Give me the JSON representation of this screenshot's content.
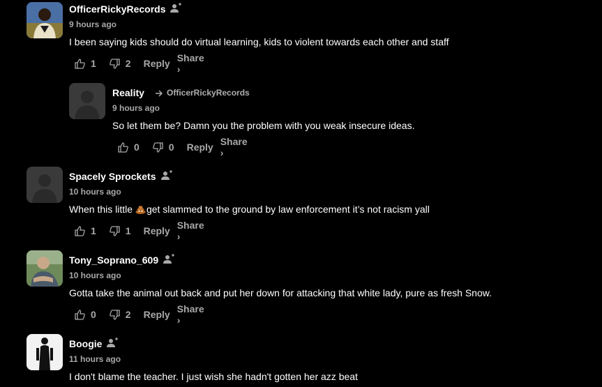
{
  "comments": [
    {
      "author": "OfficerRickyRecords",
      "time": "9 hours ago",
      "text": "I been saying kids should do virtual learning, kids to violent towards each other and staff",
      "likes": "1",
      "dislikes": "2",
      "reply_label": "Reply",
      "share_label": "Share ›",
      "avatar_icon": "user-photo-icon"
    },
    {
      "author": "Reality",
      "reply_to": "OfficerRickyRecords",
      "time": "9 hours ago",
      "text": "So let them be? Damn you the problem with you weak insecure ideas.",
      "likes": "0",
      "dislikes": "0",
      "reply_label": "Reply",
      "share_label": "Share ›",
      "avatar_icon": "default-avatar-icon"
    },
    {
      "author": "Spacely Sprockets",
      "time": "10 hours ago",
      "text_before": "When this little ",
      "text_after": "get slammed to the ground by law enforcement it’s not racism yall",
      "emoji": "poop-emoji-icon",
      "likes": "1",
      "dislikes": "1",
      "reply_label": "Reply",
      "share_label": "Share ›",
      "avatar_icon": "default-avatar-icon"
    },
    {
      "author": "Tony_Soprano_609",
      "time": "10 hours ago",
      "text": "Gotta take the animal out back and put her down for attacking that white lady, pure as fresh Snow.",
      "likes": "0",
      "dislikes": "2",
      "reply_label": "Reply",
      "share_label": "Share ›",
      "avatar_icon": "user-photo-icon"
    },
    {
      "author": "Boogie",
      "time": "11 hours ago",
      "text": "I don't blame the teacher. I just wish she hadn't gotten her azz beat",
      "avatar_icon": "user-photo-icon"
    }
  ]
}
